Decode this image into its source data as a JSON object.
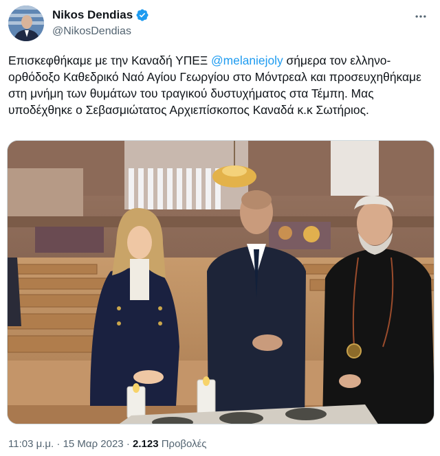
{
  "author": {
    "display_name": "Nikos Dendias",
    "handle": "@NikosDendias",
    "verified": true
  },
  "tweet": {
    "text_before": "Επισκεφθήκαμε με την Καναδή ΥΠΕΞ ",
    "mention": "@melaniejoly",
    "text_after": " σήμερα τον ελληνο-ορθόδοξο Καθεδρικό Ναό Αγίου Γεωργίου στο Μόντρεαλ και προσευχηθήκαμε στη μνήμη των θυμάτων του τραγικού δυστυχήματος στα Τέμπη. Μας υποδέχθηκε ο Σεβασμιώτατος Αρχιεπίσκοπος Καναδά κ.κ Σωτήριος."
  },
  "meta": {
    "time": "11:03 μ.μ.",
    "separator": "·",
    "date": "15 Μαρ 2023",
    "views_count": "2.123",
    "views_label": "Προβολές"
  },
  "colors": {
    "accent": "#1d9bf0",
    "text": "#0f1419",
    "secondary_text": "#536471"
  },
  "icons": {
    "verified": "verified-badge-icon",
    "more": "more-dots-icon"
  }
}
